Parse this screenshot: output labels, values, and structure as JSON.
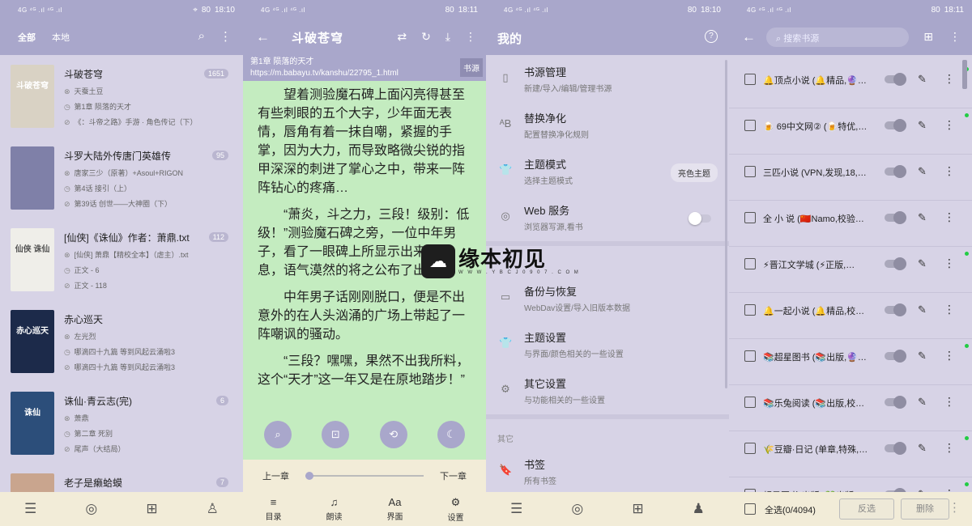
{
  "status": {
    "left": "4G ⁴ᴳ .ıl ⁴ᴳ .ıl",
    "speed1": "27 B/s",
    "speed2": "0 K/s",
    "battery": "80",
    "time": "18:10",
    "time_last": "18:11"
  },
  "shelf": {
    "tabs": [
      "全部",
      "本地"
    ],
    "books": [
      {
        "title": "斗破苍穹",
        "author": "天蚕土豆",
        "chapter": "第1章 陨落的天才",
        "latest": "《：斗帝之路》手游 · 角色传记（下）",
        "count": "1651",
        "cover_color": "#d9d2c4",
        "cover_text": "斗破苍穹"
      },
      {
        "title": "斗罗大陆外传唐门英雄传",
        "author": "唐家三少（原著）+Asoul+RIGON",
        "chapter": "第4话 接引（上）",
        "latest": "第39话 创世——大神圈（下）",
        "count": "95",
        "cover_color": "#7f80a8",
        "cover_text": ""
      },
      {
        "title": "[仙侠]《诛仙》作者：萧鼎.txt",
        "author": "[仙侠] 萧鼎【精校全本】（虐主）.txt",
        "chapter": "正文 - 6",
        "latest": "正文 - 118",
        "count": "112",
        "cover_color": "#efeee9",
        "cover_text": "仙侠 诛仙"
      },
      {
        "title": "赤心巡天",
        "author": "左光烈",
        "chapter": "哪滴四十九篇 等到风起云涌啦3",
        "latest": "哪滴四十九篇 等到风起云涌啦3",
        "count": "",
        "cover_color": "#1c2a4a",
        "cover_text": "赤心巡天"
      },
      {
        "title": "诛仙·青云志(完)",
        "author": "萧鼎",
        "chapter": "第二章 死别",
        "latest": "尾声（大结局）",
        "count": "6",
        "cover_color": "#2c4e7a",
        "cover_text": "诛仙"
      },
      {
        "title": "老子是癞蛤蟆",
        "author": "",
        "chapter": "",
        "latest": "",
        "count": "7",
        "cover_color": "#c9a58e",
        "cover_text": ""
      }
    ],
    "nav": [
      "bookshelf-icon",
      "explore-icon",
      "rss-icon",
      "profile-icon"
    ]
  },
  "reader": {
    "title": "斗破苍穹",
    "chapter_title": "第1章 陨落的天才",
    "url": "https://m.babayu.tv/kanshu/22795_1.html",
    "source_tag": "书源",
    "paragraphs": [
      "望着测验魔石碑上面闪亮得甚至有些刺眼的五个大字，少年面无表情，唇角有着一抹自嘲，紧握的手掌，因为大力，而导致略微尖锐的指甲深深的刺进了掌心之中，带来一阵阵钻心的疼痛…",
      "“萧炎，斗之力，三段！级别：低级！”测验魔石碑之旁，一位中年男子，看了一眼碑上所显示出来的信息，语气漠然的将之公布了出来…",
      "中年男子话刚刚脱口，便是不出意外的在人头汹涌的广场上带起了一阵嘲讽的骚动。",
      "“三段？嘿嘿，果然不出我所料，这个“天才”这一年又是在原地踏步！”"
    ],
    "prev": "上一章",
    "next": "下一章",
    "progress": 0,
    "tools": [
      {
        "label": "目录",
        "icon": "≡"
      },
      {
        "label": "朗读",
        "icon": "♫"
      },
      {
        "label": "界面",
        "icon": "Aa"
      },
      {
        "label": "设置",
        "icon": "⚙"
      }
    ]
  },
  "my": {
    "title": "我的",
    "items": [
      {
        "title": "书源管理",
        "sub": "新建/导入/编辑/管理书源",
        "icon": "▯"
      },
      {
        "title": "替换净化",
        "sub": "配置替换净化规则",
        "icon": "ᴬB"
      },
      {
        "title": "主题模式",
        "sub": "选择主题模式",
        "icon": "👕",
        "chip": "亮色主题"
      },
      {
        "title": "Web 服务",
        "sub": "浏览器写源,看书",
        "icon": "◎"
      },
      {
        "title": "备份与恢复",
        "sub": "WebDav设置/导入旧版本数据",
        "icon": "▭"
      },
      {
        "title": "主题设置",
        "sub": "与界面/颜色相关的一些设置",
        "icon": "👕"
      },
      {
        "title": "其它设置",
        "sub": "与功能相关的一些设置",
        "icon": "⚙"
      }
    ],
    "section_other": "其它",
    "bookmark": {
      "title": "书签",
      "sub": "所有书签",
      "icon": "🔖"
    }
  },
  "watermark": {
    "main": "缘本初见",
    "sub": "W W W . Y B C J 0 9 0 7 . C O M"
  },
  "sources": {
    "search_placeholder": "搜索书源",
    "items": [
      {
        "name": "🔔顶点小说 (🔔精品,🔮…",
        "dot": true
      },
      {
        "name": "🍺 69中文网② (🍺特优,…",
        "dot": true
      },
      {
        "name": "三匹小说 (VPN,发现,18,…",
        "dot": false
      },
      {
        "name": "全 小 说 (🇨🇳Namo,校验…",
        "dot": false
      },
      {
        "name": "⚡晋江文学城 (⚡正版,…",
        "dot": true
      },
      {
        "name": "🔔一起小说 (🔔精品,校…",
        "dot": false
      },
      {
        "name": "📚超星图书 (📚出版,🔮…",
        "dot": true
      },
      {
        "name": "📚乐兔阅读 (📚出版,校…",
        "dot": false
      },
      {
        "name": "🌾豆瓣·日记 (单章,特殊,…",
        "dot": true
      },
      {
        "name": "超星图书·出版 (💚出版…",
        "dot": true
      }
    ],
    "select_all": "全选(0/4094)",
    "invert": "反选",
    "delete": "删除"
  }
}
